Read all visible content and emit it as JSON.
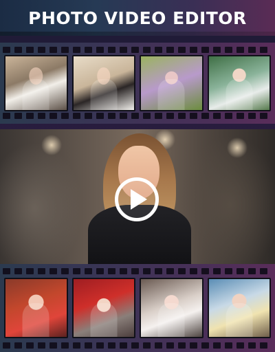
{
  "header": {
    "title": "PHOTO VIDEO EDITOR"
  },
  "top_strip": {
    "thumbnails": [
      {
        "icon": "photo-thumbnail-1"
      },
      {
        "icon": "photo-thumbnail-2"
      },
      {
        "icon": "photo-thumbnail-3"
      },
      {
        "icon": "photo-thumbnail-4"
      }
    ]
  },
  "preview": {
    "icon": "play-icon"
  },
  "bottom_strip": {
    "thumbnails": [
      {
        "icon": "photo-thumbnail-5"
      },
      {
        "icon": "photo-thumbnail-6"
      },
      {
        "icon": "photo-thumbnail-7"
      },
      {
        "icon": "photo-thumbnail-8"
      }
    ]
  },
  "colors": {
    "title_text": "#ffffff",
    "play_icon": "#ffffff",
    "strip_dark": "#2b3a4f",
    "strip_purple": "#5a2d5a"
  }
}
